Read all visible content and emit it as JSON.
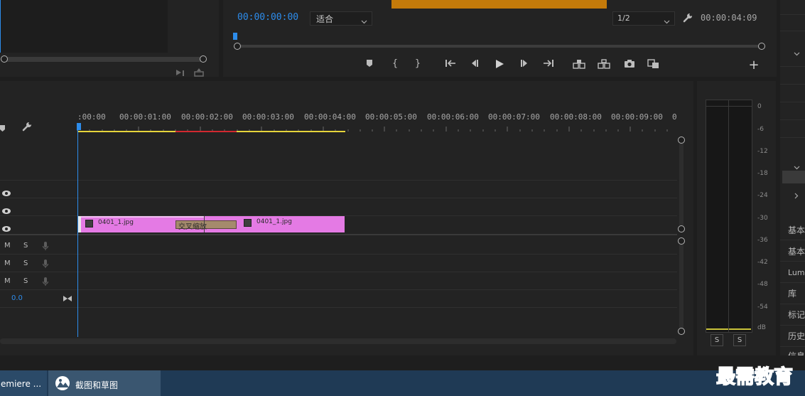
{
  "program_monitor": {
    "timecode_current": "00:00:00:00",
    "zoom_dropdown": "适合",
    "resolution_dropdown": "1/2",
    "timecode_duration": "00:00:04:09"
  },
  "timeline": {
    "ruler_labels": [
      ":00:00",
      "00:00:01:00",
      "00:00:02:00",
      "00:00:03:00",
      "00:00:04:00",
      "00:00:05:00",
      "00:00:06:00",
      "00:00:07:00",
      "00:00:08:00",
      "00:00:09:00",
      "0"
    ],
    "video_tracks": [
      {
        "visible": true
      },
      {
        "visible": true
      },
      {
        "visible": true
      }
    ],
    "audio_tracks": [
      {
        "mute": "M",
        "solo": "S"
      },
      {
        "mute": "M",
        "solo": "S"
      },
      {
        "mute": "M",
        "solo": "S"
      }
    ],
    "master_value": "0.0",
    "clips": [
      {
        "name": "0401_1.jpg",
        "track": 1
      },
      {
        "name": "0401_1.jpg",
        "track": 1
      }
    ],
    "transition_label": "交叉缩放"
  },
  "audio_meter": {
    "scale_labels": [
      "0",
      "-6",
      "-12",
      "-18",
      "-24",
      "-30",
      "-36",
      "-42",
      "-48",
      "-54",
      "dB"
    ],
    "solo_buttons": [
      "S",
      "S"
    ]
  },
  "right_panel": {
    "items": [
      "基本",
      "基本",
      "Lume",
      "库",
      "标记",
      "历史",
      "信息"
    ]
  },
  "taskbar": {
    "items": [
      {
        "label": "emiere ..."
      },
      {
        "label": "截图和草图"
      }
    ]
  },
  "watermark": {
    "text": "最需教育"
  },
  "colors": {
    "accent_blue": "#2d8ceb",
    "clip_pink": "#e47ae4",
    "transition_tan": "#a58a6c",
    "work_area_yellow": "#e6d43a",
    "render_red": "#d2292f",
    "meter_yellow": "#c9c23a",
    "taskbar": "#1f3a55"
  }
}
